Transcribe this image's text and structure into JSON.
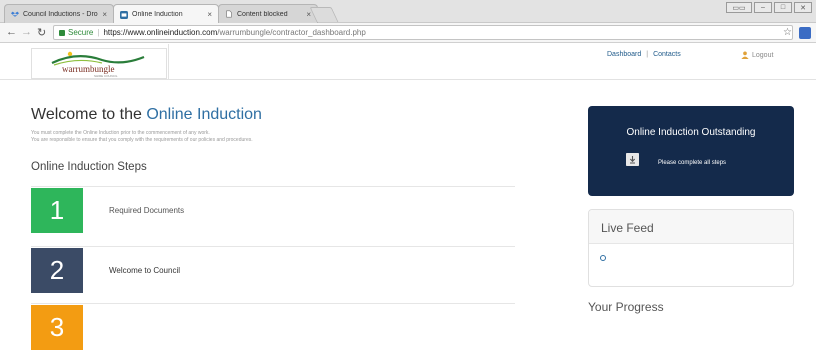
{
  "browser": {
    "tabs": [
      {
        "title": "Council Inductions - Dropb",
        "active": false
      },
      {
        "title": "Online Induction",
        "active": true
      },
      {
        "title": "Content blocked",
        "active": false
      }
    ],
    "url": {
      "secure_label": "Secure",
      "host": "https://www.onlineinduction.com",
      "path": "/warrumbungle/contractor_dashboard.php"
    }
  },
  "header": {
    "logo_text": "warrumbungle",
    "logo_subtext": "SHIRE COUNCIL",
    "nav": [
      "Dashboard",
      "Contacts"
    ],
    "logout_label": "Logout"
  },
  "main": {
    "welcome_prefix": "Welcome to the ",
    "welcome_accent": "Online Induction",
    "sub_lines": [
      "You must complete the Online Induction prior to the commencement of any work.",
      "You are responsible to ensure that you comply with the requirements of our policies and procedures."
    ],
    "steps_heading": "Online Induction Steps",
    "steps": [
      {
        "number": "1",
        "label": "Required Documents",
        "color": "#2eb65b"
      },
      {
        "number": "2",
        "label": "Welcome to Council",
        "color": "#3b4b66"
      },
      {
        "number": "3",
        "label": "",
        "color": "#f39c12"
      }
    ]
  },
  "sidebar": {
    "outstanding_title": "Online Induction Outstanding",
    "outstanding_text": "Please complete all steps",
    "live_feed_title": "Live Feed",
    "progress_title": "Your Progress"
  },
  "colors": {
    "accent": "#2f6fa3",
    "navy": "#142a4b"
  }
}
